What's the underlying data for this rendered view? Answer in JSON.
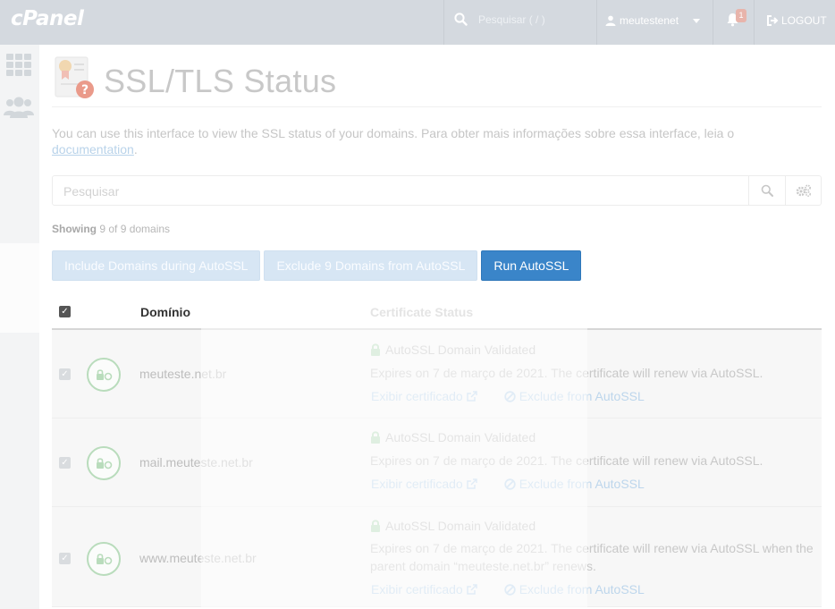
{
  "topbar": {
    "logo": "cPanel",
    "search_placeholder": "Pesquisar ( / )",
    "username": "meutestenet",
    "notification_count": "1",
    "logout_label": "LOGOUT"
  },
  "page": {
    "title": "SSL/TLS Status",
    "description": "You can use this interface to view the SSL status of your domains. Para obter mais informações sobre essa interface, leia o",
    "doc_link": "documentation",
    "doc_suffix": "."
  },
  "search": {
    "placeholder": "Pesquisar"
  },
  "showing": {
    "label": "Showing",
    "text": "9 of 9 domains"
  },
  "actions": {
    "include": "Include Domains during AutoSSL",
    "exclude": "Exclude 9 Domains from AutoSSL",
    "run": "Run AutoSSL"
  },
  "table": {
    "headers": {
      "domain": "Domínio",
      "status": "Certificate Status"
    },
    "rows": [
      {
        "domain": "meuteste.net.br",
        "status": "AutoSSL Domain Validated",
        "expires": "Expires on 7 de março de 2021. The certificate will renew via AutoSSL.",
        "view_link": "Exibir certificado",
        "exclude_link": "Exclude from AutoSSL"
      },
      {
        "domain": "mail.meuteste.net.br",
        "status": "AutoSSL Domain Validated",
        "expires": "Expires on 7 de março de 2021. The certificate will renew via AutoSSL.",
        "view_link": "Exibir certificado",
        "exclude_link": "Exclude from AutoSSL"
      },
      {
        "domain": "www.meuteste.net.br",
        "status": "AutoSSL Domain Validated",
        "expires": "Expires on 7 de março de 2021. The certificate will renew via AutoSSL when the parent domain “meuteste.net.br” renews.",
        "view_link": "Exibir certificado",
        "exclude_link": "Exclude from AutoSSL"
      }
    ]
  }
}
